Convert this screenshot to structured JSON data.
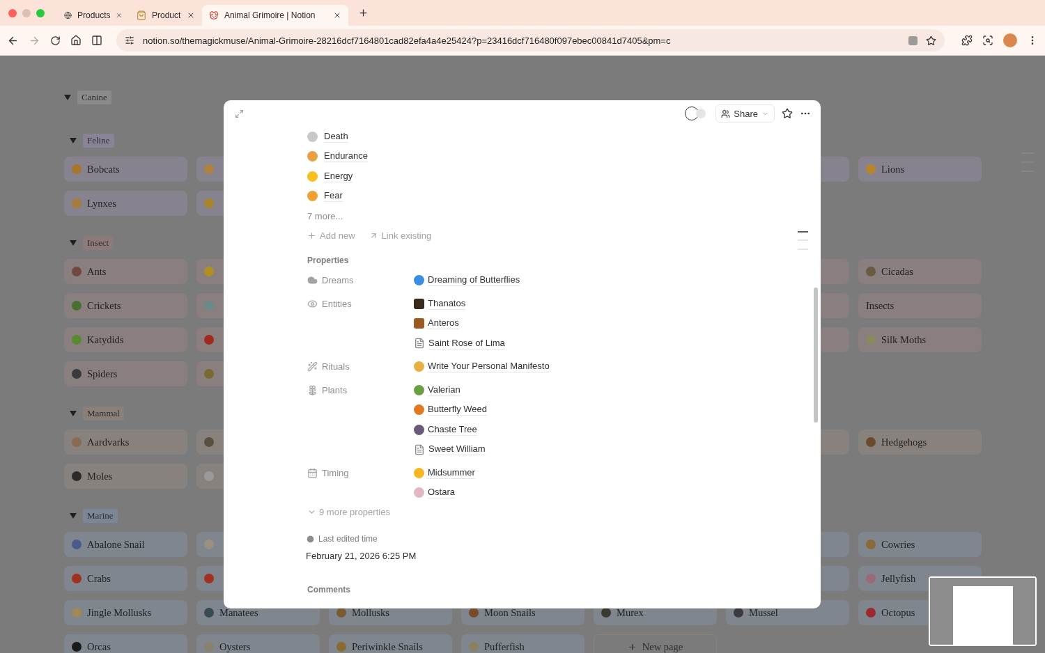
{
  "browser": {
    "tabs": [
      {
        "title": "Products",
        "kind": "globe",
        "selected": false
      },
      {
        "title": "Product",
        "kind": "bag",
        "selected": false
      },
      {
        "title": "Animal Grimoire | Notion",
        "kind": "dog",
        "selected": true
      }
    ],
    "url": "notion.so/themagickmuse/Animal-Grimoire-28216dcf7164801cad82efa4a4e25424?p=23416dcf716480f097ebec00841d7405&pm=c"
  },
  "board": {
    "groups": [
      {
        "label": "Canine",
        "color": "#8a8a8a",
        "children": [
          {
            "label": "Feline",
            "color": "#8a8296",
            "rows": [
              [
                {
                  "kind": "page",
                  "label": "Bobcats",
                  "color": "#a8752c"
                },
                {
                  "kind": "clipped",
                  "color": "#b08040"
                },
                {
                  "kind": "hidden"
                },
                {
                  "kind": "hidden"
                },
                {
                  "kind": "hidden"
                },
                {
                  "kind": "covered"
                },
                {
                  "kind": "page",
                  "label": "Lions",
                  "color": "#b8862a"
                }
              ],
              [
                {
                  "kind": "page",
                  "label": "Lynxes",
                  "color": "#a87a40"
                },
                {
                  "kind": "clipped",
                  "color": "#a8842c"
                }
              ]
            ]
          },
          {
            "label": "Insect",
            "color": "#8c7b7a",
            "rows": [
              [
                {
                  "kind": "page",
                  "label": "Ants",
                  "color": "#704a40"
                },
                {
                  "kind": "clipped",
                  "color": "#b09020"
                },
                {
                  "kind": "hidden"
                },
                {
                  "kind": "hidden"
                },
                {
                  "kind": "hidden"
                },
                {
                  "kind": "covered"
                },
                {
                  "kind": "page",
                  "label": "Cicadas",
                  "color": "#6a5a40"
                }
              ],
              [
                {
                  "kind": "page",
                  "label": "Crickets",
                  "color": "#4a7030"
                },
                {
                  "kind": "clipped",
                  "color": "#6a8a8a"
                },
                {
                  "kind": "hidden"
                },
                {
                  "kind": "hidden"
                },
                {
                  "kind": "hidden"
                },
                {
                  "kind": "covered"
                },
                {
                  "kind": "text",
                  "label": "Insects"
                }
              ],
              [
                {
                  "kind": "page",
                  "label": "Katydids",
                  "color": "#5a8a30"
                },
                {
                  "kind": "clipped",
                  "color": "#a02a20"
                },
                {
                  "kind": "hidden"
                },
                {
                  "kind": "hidden"
                },
                {
                  "kind": "hidden"
                },
                {
                  "kind": "covered"
                },
                {
                  "kind": "page",
                  "label": "Silk Moths",
                  "color": "#8a8a60"
                }
              ],
              [
                {
                  "kind": "page",
                  "label": "Spiders",
                  "color": "#3a3a3a"
                },
                {
                  "kind": "clipped",
                  "color": "#7a6a30"
                }
              ]
            ]
          },
          {
            "label": "Mammal",
            "color": "#8a807a",
            "rows": [
              [
                {
                  "kind": "page",
                  "label": "Aardvarks",
                  "color": "#8a6a50"
                },
                {
                  "kind": "clipped",
                  "color": "#5a5040"
                },
                {
                  "kind": "hidden"
                },
                {
                  "kind": "hidden"
                },
                {
                  "kind": "hidden"
                },
                {
                  "kind": "covered"
                },
                {
                  "kind": "page",
                  "label": "Hedgehogs",
                  "color": "#6a4a2a"
                }
              ],
              [
                {
                  "kind": "page",
                  "label": "Moles",
                  "color": "#2a2a2a"
                },
                {
                  "kind": "clipped",
                  "color": "#9a9a9a"
                }
              ]
            ]
          },
          {
            "label": "Marine",
            "color": "#7b8796",
            "rows": [
              [
                {
                  "kind": "page",
                  "label": "Abalone Snail",
                  "color": "#4a5a8a"
                },
                {
                  "kind": "clipped",
                  "color": "#9a9080"
                },
                {
                  "kind": "hidden"
                },
                {
                  "kind": "hidden"
                },
                {
                  "kind": "hidden"
                },
                {
                  "kind": "covered"
                },
                {
                  "kind": "page",
                  "label": "Cowries",
                  "color": "#8a6a3a"
                }
              ],
              [
                {
                  "kind": "page",
                  "label": "Crabs",
                  "color": "#a03020"
                },
                {
                  "kind": "clipped",
                  "color": "#a03020"
                },
                {
                  "kind": "hidden"
                },
                {
                  "kind": "hidden"
                },
                {
                  "kind": "hidden"
                },
                {
                  "kind": "covered"
                },
                {
                  "kind": "page",
                  "label": "Jellyfish",
                  "color": "#9a6a7a"
                }
              ],
              [
                {
                  "kind": "page",
                  "label": "Jingle Mollusks",
                  "color": "#a0885a"
                },
                {
                  "kind": "page",
                  "label": "Manatees",
                  "color": "#3a4a55"
                },
                {
                  "kind": "page",
                  "label": "Mollusks",
                  "color": "#7a5a30"
                },
                {
                  "kind": "page",
                  "label": "Moon Snails",
                  "color": "#7a4a2a"
                },
                {
                  "kind": "page",
                  "label": "Murex",
                  "color": "#3a3a30"
                },
                {
                  "kind": "page",
                  "label": "Mussel",
                  "color": "#3a3a40"
                },
                {
                  "kind": "page",
                  "label": "Octopus",
                  "color": "#9a2a30"
                }
              ],
              [
                {
                  "kind": "page",
                  "label": "Orcas",
                  "color": "#1a1a1a"
                },
                {
                  "kind": "page",
                  "label": "Oysters",
                  "color": "#8a8070"
                },
                {
                  "kind": "page",
                  "label": "Periwinkle Snails",
                  "color": "#8a6a30"
                },
                {
                  "kind": "page",
                  "label": "Pufferfish",
                  "color": "#8a8060"
                },
                {
                  "kind": "new",
                  "label": "New page"
                }
              ]
            ]
          }
        ]
      }
    ]
  },
  "modal": {
    "share": "Share",
    "related": [
      {
        "label": "Death",
        "color": "#c8c8c8"
      },
      {
        "label": "Endurance",
        "color": "#e8a040"
      },
      {
        "label": "Energy",
        "color": "#f5c020"
      },
      {
        "label": "Fear",
        "color": "#f0a030"
      }
    ],
    "more": "7 more...",
    "add_new": "Add new",
    "link_existing": "Link existing",
    "properties_title": "Properties",
    "properties": [
      {
        "label": "Dreams",
        "kind": "cloud",
        "values": [
          {
            "label": "Dreaming of Butterflies",
            "kind": "emoji",
            "color": "#3a8ee0"
          }
        ]
      },
      {
        "label": "Entities",
        "kind": "eye",
        "values": [
          {
            "label": "Thanatos",
            "kind": "image",
            "color": "#3a2a1a"
          },
          {
            "label": "Anteros",
            "kind": "image",
            "color": "#9a5a20"
          },
          {
            "label": "Saint Rose of Lima",
            "kind": "doc"
          }
        ]
      },
      {
        "label": "Rituals",
        "kind": "wand",
        "values": [
          {
            "label": "Write Your Personal Manifesto",
            "kind": "emoji",
            "color": "#e8b040"
          }
        ]
      },
      {
        "label": "Plants",
        "kind": "plant",
        "values": [
          {
            "label": "Valerian",
            "kind": "emoji",
            "color": "#6aa040"
          },
          {
            "label": "Butterfly Weed",
            "kind": "emoji",
            "color": "#e07a20"
          },
          {
            "label": "Chaste Tree",
            "kind": "emoji",
            "color": "#6a5a7a"
          },
          {
            "label": "Sweet William",
            "kind": "doc"
          }
        ]
      },
      {
        "label": "Timing",
        "kind": "calendar",
        "values": [
          {
            "label": "Midsummer",
            "kind": "emoji",
            "color": "#f5b820"
          },
          {
            "label": "Ostara",
            "kind": "emoji",
            "color": "#e0b8c0"
          }
        ]
      }
    ],
    "more_properties": "9 more properties",
    "last_edited_label": "Last edited time",
    "last_edited_value": "February 21, 2026 6:25 PM",
    "comments_title": "Comments"
  }
}
